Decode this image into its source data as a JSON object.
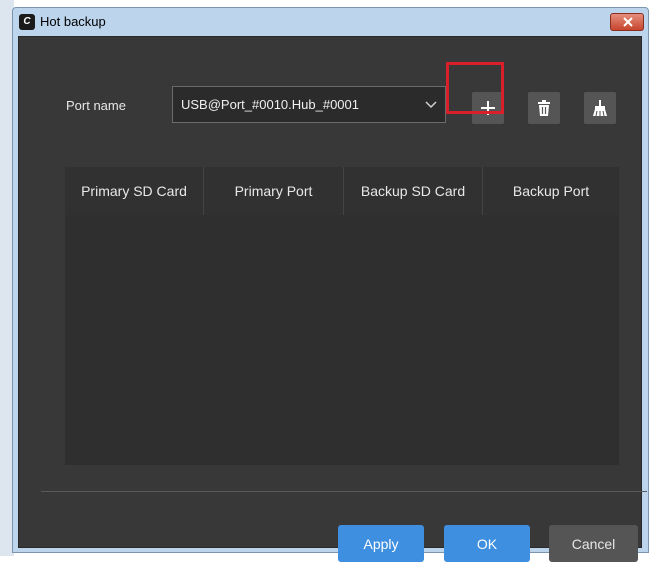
{
  "window": {
    "title": "Hot backup",
    "app_icon_glyph": "C",
    "close_icon": "close-icon"
  },
  "port": {
    "label": "Port name",
    "selected": "USB@Port_#0010.Hub_#0001",
    "dropdown_icon": "chevron-down-icon"
  },
  "toolbar": {
    "add_icon": "plus-icon",
    "delete_icon": "trash-icon",
    "clear_icon": "broom-icon",
    "highlight_color": "#d9202a"
  },
  "table": {
    "headers": [
      "Primary SD Card",
      "Primary Port",
      "Backup SD Card",
      "Backup Port"
    ],
    "rows": []
  },
  "buttons": {
    "apply": "Apply",
    "ok": "OK",
    "cancel": "Cancel"
  },
  "colors": {
    "accent": "#3e8fe0",
    "panel": "#383838",
    "title_bar": "#bcd4ec",
    "close": "#c6452d"
  }
}
